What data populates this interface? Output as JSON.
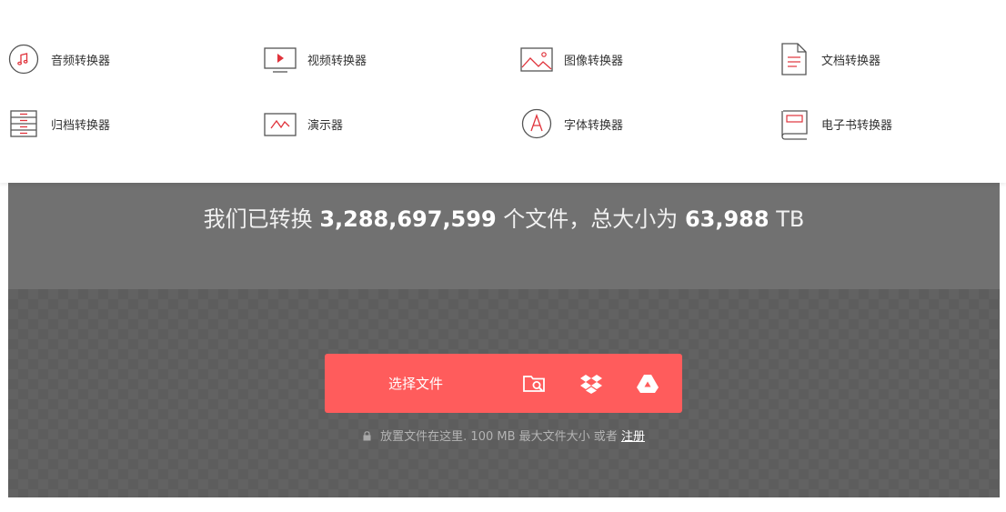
{
  "menu": {
    "items": [
      {
        "label": "音频转换器",
        "icon": "music-note-icon"
      },
      {
        "label": "视频转换器",
        "icon": "video-player-icon"
      },
      {
        "label": "图像转换器",
        "icon": "image-icon"
      },
      {
        "label": "文档转换器",
        "icon": "document-icon"
      },
      {
        "label": "归档转换器",
        "icon": "archive-icon"
      },
      {
        "label": "演示器",
        "icon": "presentation-icon"
      },
      {
        "label": "字体转换器",
        "icon": "font-icon"
      },
      {
        "label": "电子书转换器",
        "icon": "ebook-icon"
      }
    ]
  },
  "stats": {
    "prefix": "我们已转换",
    "files_count": "3,288,697,599",
    "middle": "个文件，总大小为",
    "total_size": "63,988",
    "unit": "TB"
  },
  "upload": {
    "choose_label": "选择文件",
    "icons": [
      "folder-search-icon",
      "dropbox-icon",
      "google-drive-icon"
    ],
    "hint_text": "放置文件在这里. 100 MB 最大文件大小 或者",
    "register_link": "注册"
  },
  "colors": {
    "accent": "#ff5c5c",
    "stage_bg": "#6b6b6b",
    "icon_red": "#e0333b"
  }
}
